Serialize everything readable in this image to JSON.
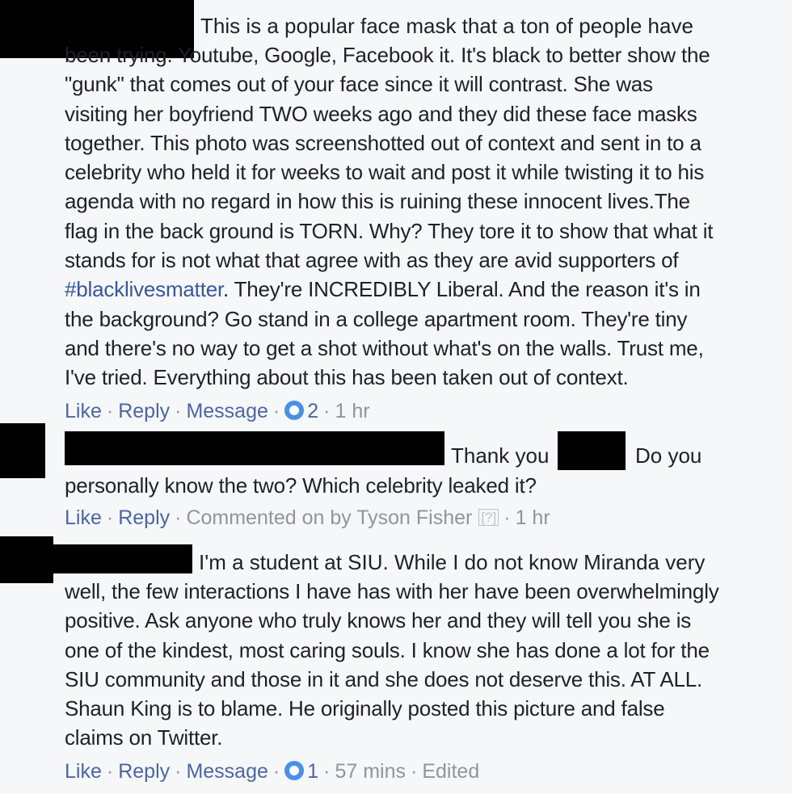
{
  "comments": [
    {
      "lead": "This is a popular face mask that a ton of people have",
      "body_pre": "been trying. Youtube, Google, Facebook it. It's black to better show the\n\"gunk\" that comes out of your face since it will contrast. She was\nvisiting her boyfriend TWO weeks ago and they did these face masks\ntogether. This photo was screenshotted out of context and sent in to a\ncelebrity who held it for weeks to wait and post it while twisting it to his\nagenda with no regard in how this is ruining these innocent lives.The\nflag in the back ground is TORN. Why? They tore it to show that what it\nstands for is not what that agree with as they are avid supporters of\n",
      "hashtag": "#blacklivesmatter",
      "body_post": ". They're INCREDIBLY Liberal. And the reason it's in\nthe background? Go stand in a college apartment room. They're tiny\nand there's no way to get a shot without what's on the walls. Trust me,\nI've tried. Everything about this has been taken out of context.",
      "actions": {
        "like": "Like",
        "reply": "Reply",
        "message": "Message",
        "reactions": "2",
        "time": "1 hr"
      }
    },
    {
      "lead_a": "Thank you",
      "lead_b": "Do you",
      "body": "personally know the two? Which celebrity leaked it?",
      "actions": {
        "like": "Like",
        "reply": "Reply",
        "commented_by": "Commented on by Tyson Fisher",
        "help": "[?]",
        "time": "1 hr"
      }
    },
    {
      "lead": "I'm a student at SIU. While I do not know Miranda very",
      "body": "well, the few interactions I have has with her have been overwhelmingly\npositive. Ask anyone who truly knows her and they will tell you she is\none of the kindest, most caring souls. I know she has done a lot for the\nSIU community and those in it and she does not deserve this. AT ALL.\nShaun King is to blame. He originally posted this picture and false\nclaims on Twitter.",
      "actions": {
        "like": "Like",
        "reply": "Reply",
        "message": "Message",
        "reactions": "1",
        "time": "57 mins",
        "edited": "Edited"
      }
    }
  ]
}
